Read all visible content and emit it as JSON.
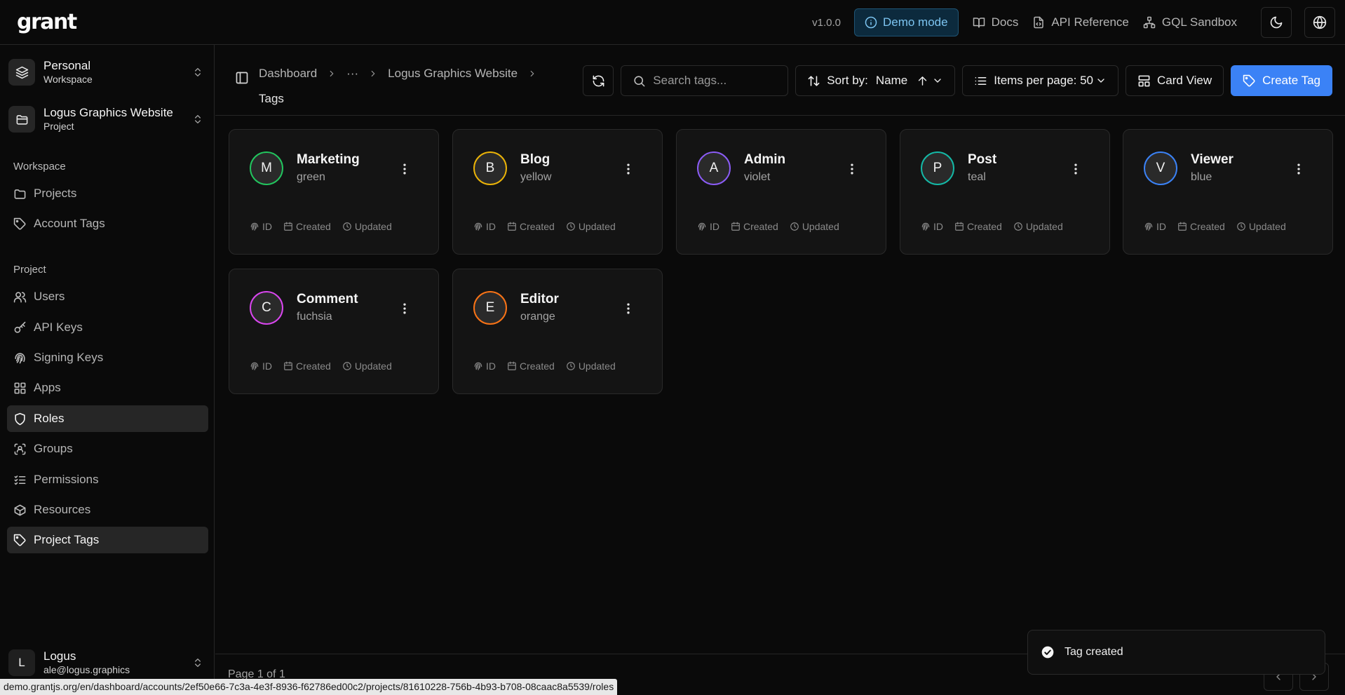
{
  "app": {
    "logo": "grant",
    "version": "v1.0.0"
  },
  "header": {
    "demo_label": "Demo mode",
    "links": [
      {
        "label": "Docs",
        "icon": "book-icon"
      },
      {
        "label": "API Reference",
        "icon": "file-code-icon"
      },
      {
        "label": "GQL Sandbox",
        "icon": "network-icon"
      }
    ],
    "theme_icon": "moon-icon",
    "language_icon": "globe-icon"
  },
  "sidebar": {
    "workspace_switcher": {
      "title": "Personal",
      "subtitle": "Workspace"
    },
    "project_switcher": {
      "title": "Logus Graphics Website",
      "subtitle": "Project"
    },
    "workspace_section": "Workspace",
    "workspace_items": [
      {
        "label": "Projects",
        "icon": "folder-icon"
      },
      {
        "label": "Account Tags",
        "icon": "tag-icon"
      }
    ],
    "project_section": "Project",
    "project_items": [
      {
        "label": "Users",
        "icon": "users-icon"
      },
      {
        "label": "API Keys",
        "icon": "key-icon"
      },
      {
        "label": "Signing Keys",
        "icon": "fingerprint-icon"
      },
      {
        "label": "Apps",
        "icon": "grid-icon"
      },
      {
        "label": "Roles",
        "icon": "shield-icon"
      },
      {
        "label": "Groups",
        "icon": "group-icon"
      },
      {
        "label": "Permissions",
        "icon": "list-check-icon"
      },
      {
        "label": "Resources",
        "icon": "box-icon"
      },
      {
        "label": "Project Tags",
        "icon": "tag-icon"
      }
    ],
    "user": {
      "initial": "L",
      "name": "Logus",
      "email": "ale@logus.graphics"
    }
  },
  "breadcrumb": {
    "items": [
      "Dashboard",
      "···",
      "Logus Graphics Website"
    ],
    "current": "Tags"
  },
  "toolbar": {
    "search_placeholder": "Search tags...",
    "sort_label": "Sort by:",
    "sort_value": "Name",
    "items_per_page": "Items per page: 50",
    "view_label": "Card View",
    "create_label": "Create Tag"
  },
  "tags": [
    {
      "initial": "M",
      "name": "Marketing",
      "color": "green",
      "hex": "#22c55e"
    },
    {
      "initial": "B",
      "name": "Blog",
      "color": "yellow",
      "hex": "#eab308"
    },
    {
      "initial": "A",
      "name": "Admin",
      "color": "violet",
      "hex": "#8b5cf6"
    },
    {
      "initial": "P",
      "name": "Post",
      "color": "teal",
      "hex": "#14b8a6"
    },
    {
      "initial": "V",
      "name": "Viewer",
      "color": "blue",
      "hex": "#3b82f6"
    },
    {
      "initial": "C",
      "name": "Comment",
      "color": "fuchsia",
      "hex": "#d946ef"
    },
    {
      "initial": "E",
      "name": "Editor",
      "color": "orange",
      "hex": "#f97316"
    }
  ],
  "card_meta": {
    "id": "ID",
    "created": "Created",
    "updated": "Updated"
  },
  "footer": {
    "page_info": "Page 1 of 1"
  },
  "toast": {
    "message": "Tag created"
  },
  "status_url": "demo.grantjs.org/en/dashboard/accounts/2ef50e66-7c3a-4e3f-8936-f62786ed00c2/projects/81610228-756b-4b93-b708-08caac8a5539/roles",
  "colors": {
    "accent": "#3b82f6",
    "background": "#0a0a0a"
  }
}
